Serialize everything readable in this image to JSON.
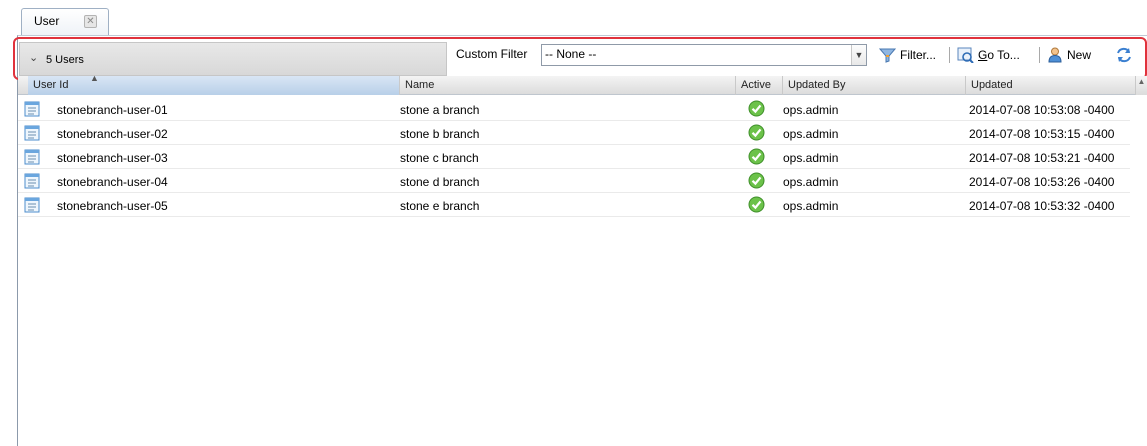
{
  "tabs": [
    {
      "label": "User"
    }
  ],
  "toolbar": {
    "group_label": "5 Users",
    "filter_label": "Custom Filter",
    "filter_value": "-- None --",
    "filter_btn": "Filter...",
    "goto_prefix": "G",
    "goto_rest": "o To...",
    "new_btn": "New"
  },
  "grid": {
    "columns": [
      "User Id",
      "Name",
      "Active",
      "Updated By",
      "Updated"
    ],
    "rows": [
      {
        "user_id": "stonebranch-user-01",
        "name": "stone a branch",
        "updated_by": "ops.admin",
        "updated": "2014-07-08 10:53:08 -0400"
      },
      {
        "user_id": "stonebranch-user-02",
        "name": "stone b branch",
        "updated_by": "ops.admin",
        "updated": "2014-07-08 10:53:15 -0400"
      },
      {
        "user_id": "stonebranch-user-03",
        "name": "stone c branch",
        "updated_by": "ops.admin",
        "updated": "2014-07-08 10:53:21 -0400"
      },
      {
        "user_id": "stonebranch-user-04",
        "name": "stone d branch",
        "updated_by": "ops.admin",
        "updated": "2014-07-08 10:53:26 -0400"
      },
      {
        "user_id": "stonebranch-user-05",
        "name": "stone e branch",
        "updated_by": "ops.admin",
        "updated": "2014-07-08 10:53:32 -0400"
      }
    ]
  },
  "colors": {
    "highlight": "#e0323c",
    "active_green": "#6cc24a",
    "sort_header": "#c6d9ee"
  },
  "icons": {
    "row": "record-icon",
    "active": "check-circle-icon"
  }
}
